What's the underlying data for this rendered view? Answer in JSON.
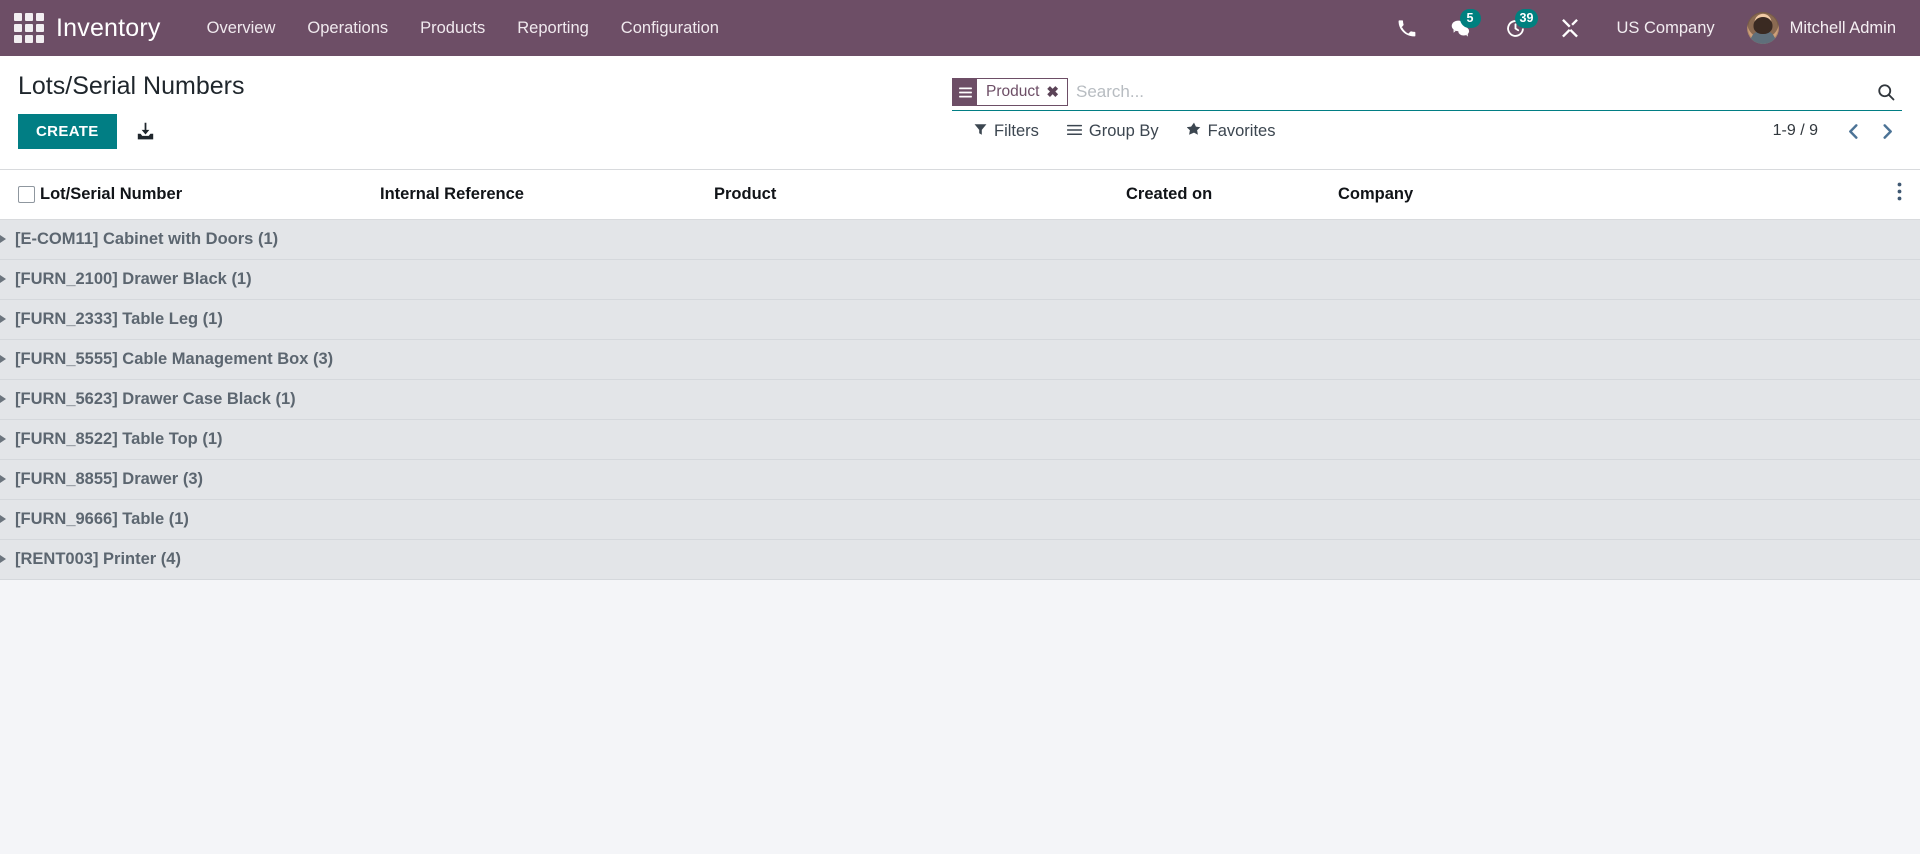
{
  "navbar": {
    "apps_icon": "apps-grid-icon",
    "brand": "Inventory",
    "menus": [
      {
        "label": "Overview"
      },
      {
        "label": "Operations"
      },
      {
        "label": "Products"
      },
      {
        "label": "Reporting"
      },
      {
        "label": "Configuration"
      }
    ],
    "icons": [
      {
        "name": "phone-icon",
        "badge": null
      },
      {
        "name": "messaging-icon",
        "badge": "5"
      },
      {
        "name": "activities-clock-icon",
        "badge": "39"
      },
      {
        "name": "developer-tools-icon",
        "badge": null
      }
    ],
    "company": "US Company",
    "user": "Mitchell Admin"
  },
  "control_panel": {
    "title": "Lots/Serial Numbers",
    "create_label": "CREATE",
    "import_icon": "import-download-icon",
    "search": {
      "placeholder": "Search...",
      "value": "",
      "facets": [
        {
          "icon": "group-by-icon",
          "label": "Product",
          "remove": "✖"
        }
      ],
      "search_icon": "search-icon"
    },
    "dropdowns": [
      {
        "name": "filters",
        "icon": "filter-funnel-icon",
        "label": "Filters"
      },
      {
        "name": "group-by",
        "icon": "group-by-icon",
        "label": "Group By"
      },
      {
        "name": "favorites",
        "icon": "star-icon",
        "label": "Favorites"
      }
    ],
    "pager": {
      "value": "1-9 / 9",
      "previous_icon": "chevron-left-icon",
      "next_icon": "chevron-right-icon"
    }
  },
  "table": {
    "columns": [
      {
        "key": "lot",
        "label": "Lot/Serial Number"
      },
      {
        "key": "internal_reference",
        "label": "Internal Reference"
      },
      {
        "key": "product",
        "label": "Product"
      },
      {
        "key": "created_on",
        "label": "Created on"
      },
      {
        "key": "company",
        "label": "Company"
      }
    ],
    "options_icon": "vertical-dots-icon",
    "groups": [
      {
        "label": "[E-COM11] Cabinet with Doors",
        "count": "(1)"
      },
      {
        "label": "[FURN_2100] Drawer Black",
        "count": "(1)"
      },
      {
        "label": "[FURN_2333] Table Leg",
        "count": "(1)"
      },
      {
        "label": "[FURN_5555] Cable Management Box",
        "count": "(3)"
      },
      {
        "label": "[FURN_5623] Drawer Case Black",
        "count": "(1)"
      },
      {
        "label": "[FURN_8522] Table Top",
        "count": "(1)"
      },
      {
        "label": "[FURN_8855] Drawer",
        "count": "(3)"
      },
      {
        "label": "[FURN_9666] Table",
        "count": "(1)"
      },
      {
        "label": "[RENT003] Printer",
        "count": "(4)"
      }
    ]
  },
  "colors": {
    "navbar": "#6d4e66",
    "accent_teal": "#017e84",
    "badge": "#00807f",
    "group_row_bg": "#e3e5e8",
    "page_bg": "#f4f5f8"
  }
}
